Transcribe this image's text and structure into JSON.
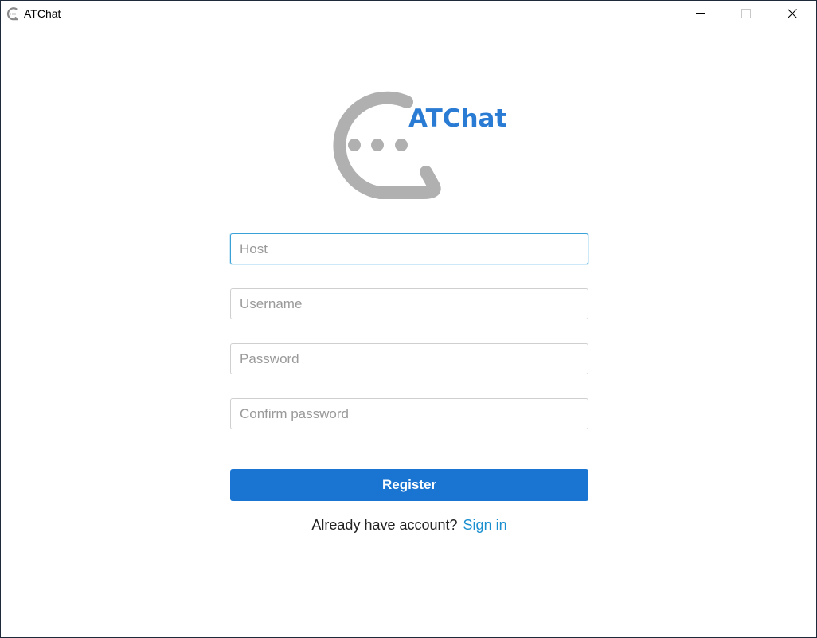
{
  "window": {
    "title": "ATChat",
    "controls": {
      "minimize": "minimize-icon",
      "maximize": "maximize-icon",
      "close": "close-icon"
    }
  },
  "logo": {
    "text": "ATChat",
    "text_color": "#2a7bd3",
    "mark_color": "#b0b0b0"
  },
  "form": {
    "host": {
      "placeholder": "Host",
      "value": "",
      "focused": true
    },
    "username": {
      "placeholder": "Username",
      "value": ""
    },
    "password": {
      "placeholder": "Password",
      "value": ""
    },
    "confirm_password": {
      "placeholder": "Confirm password",
      "value": ""
    },
    "register_label": "Register",
    "button_color": "#1a75d2"
  },
  "footer": {
    "prompt": "Already have account?",
    "link_label": "Sign in",
    "link_color": "#1a8fd0"
  }
}
